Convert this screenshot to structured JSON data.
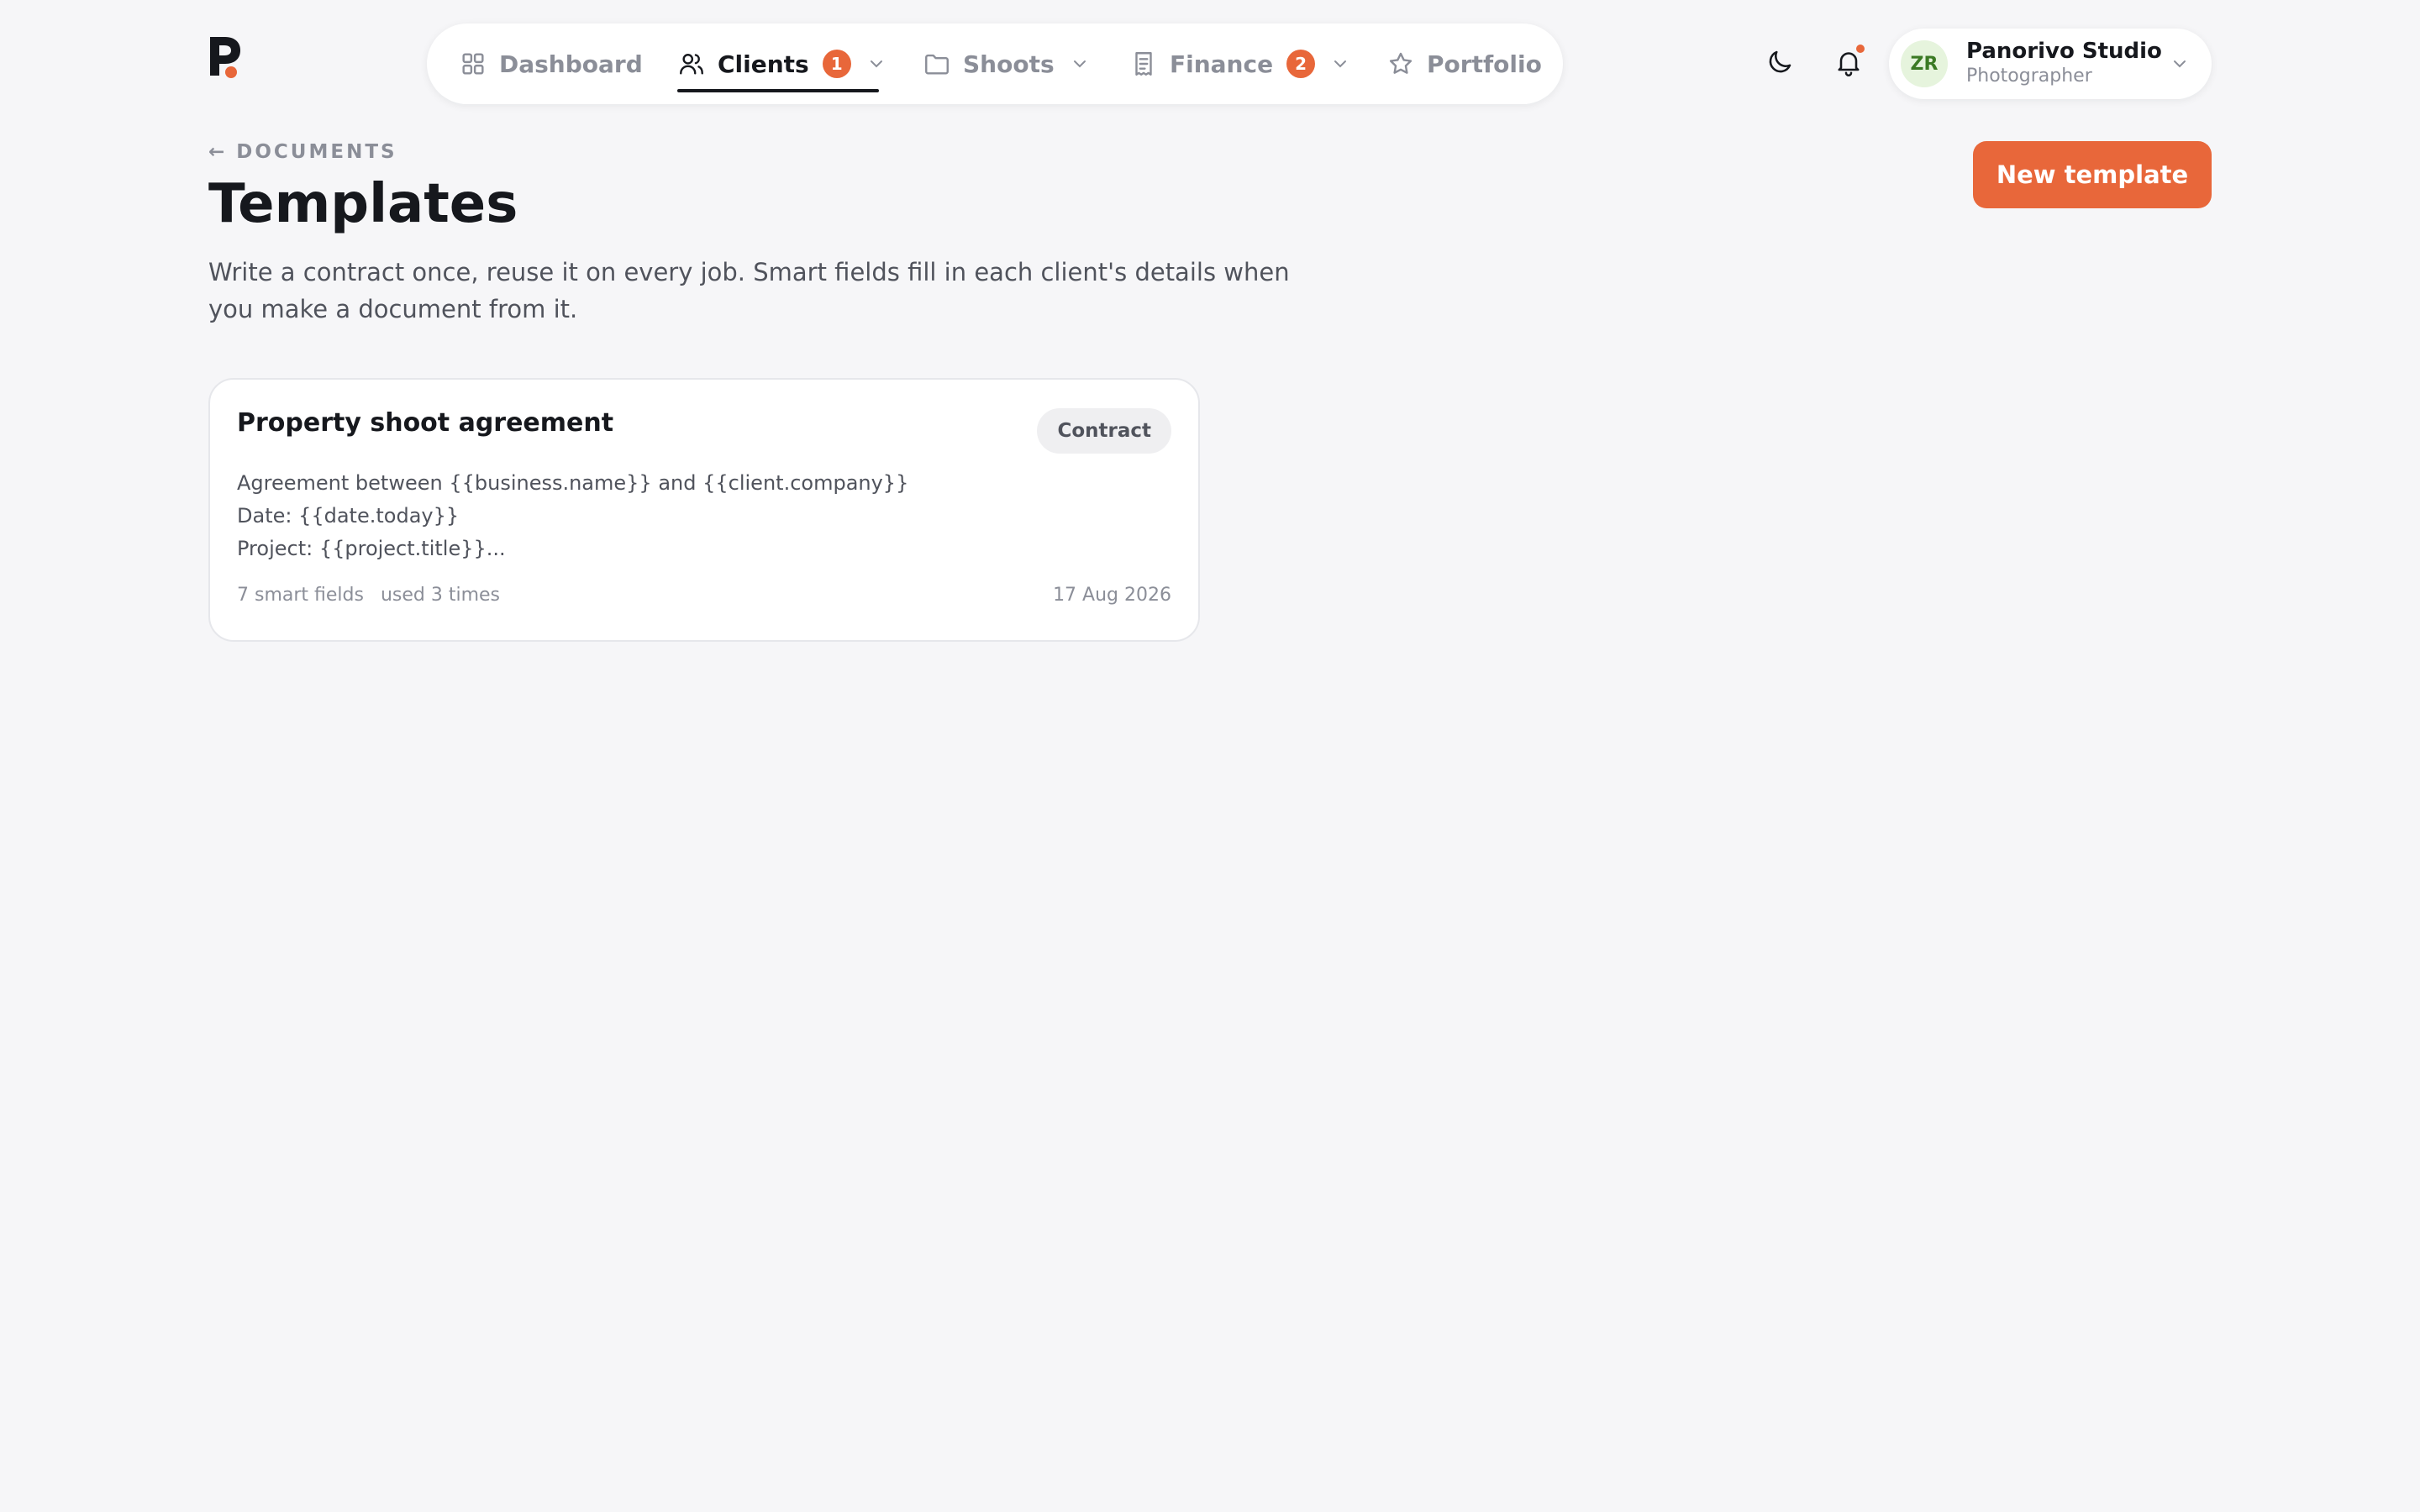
{
  "brand": {
    "logo_letter": "P",
    "accent_color": "#e8673a"
  },
  "nav": {
    "items": [
      {
        "label": "Dashboard",
        "icon": "grid-icon"
      },
      {
        "label": "Clients",
        "icon": "users-icon",
        "badge": "1",
        "active": true
      },
      {
        "label": "Shoots",
        "icon": "folder-icon"
      },
      {
        "label": "Finance",
        "icon": "receipt-icon",
        "badge": "2"
      },
      {
        "label": "Portfolio",
        "icon": "star-icon"
      }
    ]
  },
  "header_controls": {
    "theme_icon": "moon-icon",
    "notifications_icon": "bell-icon"
  },
  "profile": {
    "initials": "ZR",
    "name": "Panorivo Studio",
    "role": "Photographer"
  },
  "page": {
    "breadcrumb": "← DOCUMENTS",
    "title": "Templates",
    "description": "Write a contract once, reuse it on every job. Smart fields fill in each client's details when you make a document from it.",
    "new_button": "New template"
  },
  "templates": [
    {
      "title": "Property shoot agreement",
      "tag": "Contract",
      "preview_lines": [
        "Agreement between {{business.name}} and {{client.company}}",
        "Date: {{date.today}}",
        "Project: {{project.title}}..."
      ],
      "fields": "7 smart fields",
      "usage": "used 3 times",
      "date": "17 Aug 2026"
    }
  ]
}
